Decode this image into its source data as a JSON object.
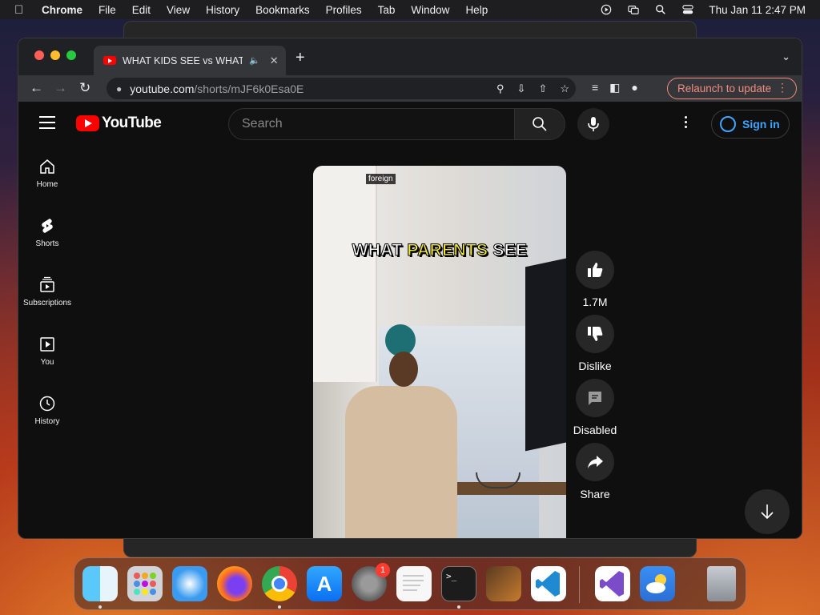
{
  "menubar": {
    "app": "Chrome",
    "items": [
      "File",
      "Edit",
      "View",
      "History",
      "Bookmarks",
      "Profiles",
      "Tab",
      "Window",
      "Help"
    ],
    "clock": "Thu Jan 11  2:47 PM"
  },
  "browser": {
    "tab_title": "WHAT KIDS SEE vs WHAT PARENTS SEE",
    "url_host": "youtube.com",
    "url_path": "/shorts/mJF6k0Esa0E",
    "relaunch_label": "Relaunch to update"
  },
  "youtube": {
    "logo_text": "YouTube",
    "search_placeholder": "Search",
    "signin_label": "Sign in",
    "nav": [
      {
        "label": "Home",
        "icon": "home-icon"
      },
      {
        "label": "Shorts",
        "icon": "shorts-icon"
      },
      {
        "label": "Subscriptions",
        "icon": "subscriptions-icon"
      },
      {
        "label": "You",
        "icon": "you-icon"
      },
      {
        "label": "History",
        "icon": "history-icon"
      }
    ],
    "video": {
      "badge": "foreign",
      "caption_pre": "WHAT ",
      "caption_hl": "PARENTS",
      "caption_post": " SEE"
    },
    "actions": {
      "like": "1.7M",
      "dislike": "Dislike",
      "comments": "Disabled",
      "share": "Share"
    }
  },
  "dock": {
    "apps": [
      "Finder",
      "Launchpad",
      "Safari",
      "Firefox",
      "Chrome",
      "App Store",
      "System Settings",
      "TextEdit",
      "Terminal",
      "GarageBand",
      "VS Code",
      "Visual Studio",
      "Weather",
      "Trash"
    ],
    "settings_badge": "1"
  }
}
